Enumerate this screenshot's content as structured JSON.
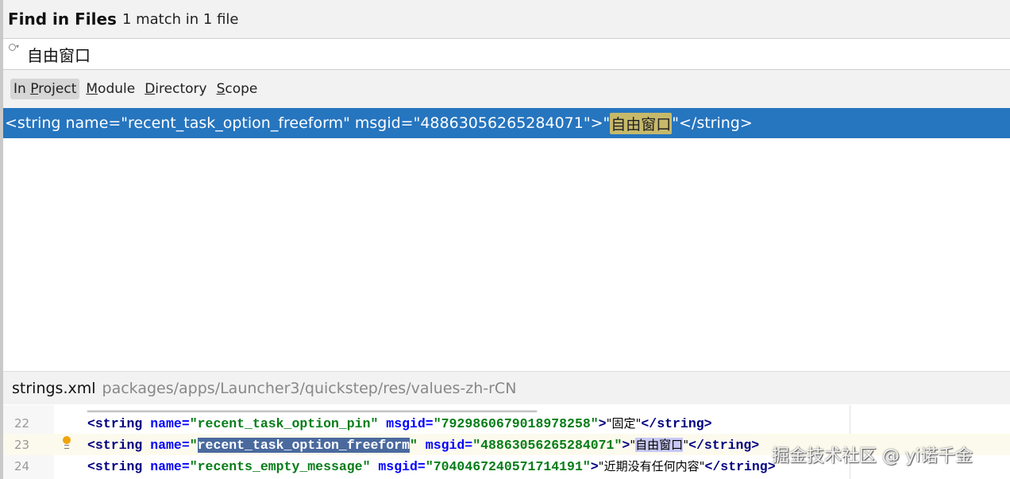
{
  "header": {
    "title": "Find in Files",
    "match_count": "1 match in 1 file"
  },
  "search": {
    "value": "自由窗口",
    "icon": "search-icon"
  },
  "scopes": [
    {
      "pre": "In ",
      "u": "P",
      "post": "roject",
      "active": true
    },
    {
      "pre": "",
      "u": "M",
      "post": "odule",
      "active": false
    },
    {
      "pre": "",
      "u": "D",
      "post": "irectory",
      "active": false
    },
    {
      "pre": "",
      "u": "S",
      "post": "cope",
      "active": false
    }
  ],
  "result": {
    "before": "<string name=\"recent_task_option_freeform\" msgid=\"4886305626528407 1\">\"",
    "match": "自由窗口",
    "after": "\"</string>"
  },
  "file": {
    "name": "strings.xml",
    "path": "packages/apps/Launcher3/quickstep/res/values-zh-rCN"
  },
  "editor": {
    "lines": [
      {
        "num": "22",
        "name": "recent_task_option_pin",
        "msgid": "7929860679018978258",
        "text": "固定"
      },
      {
        "num": "23",
        "name": "recent_task_option_freeform",
        "msgid": "48863056265284071",
        "text": "自由窗口"
      },
      {
        "num": "24",
        "name": "recents_empty_message",
        "msgid": "7040467240571714191",
        "text": "近期没有任何内容"
      }
    ]
  },
  "colors": {
    "selection": "#2675bf",
    "match_highlight": "#c6b96a",
    "xml_tag": "#000080",
    "xml_value": "#067d17"
  },
  "watermark": "掘金技术社区 @ yi诺千金"
}
